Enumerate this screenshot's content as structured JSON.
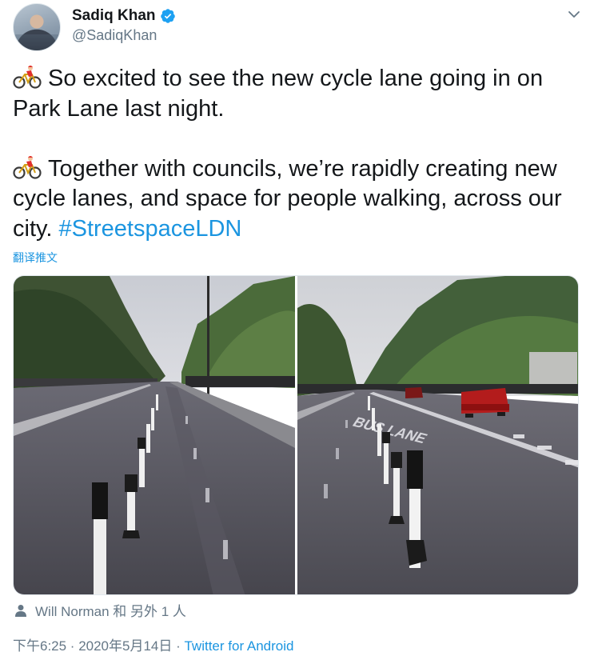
{
  "author": {
    "display_name": "Sadiq Khan",
    "handle": "@SadiqKhan",
    "verified": true
  },
  "tweet": {
    "paragraph1": "So excited to see the new cycle lane going in on Park Lane last night.",
    "paragraph2": "Together with councils, we’re rapidly creating new cycle lanes, and space for people walking, across our city.",
    "hashtag": "#StreetspaceLDN",
    "emoji": "cyclist-emoji"
  },
  "translate_label": "翻译推文",
  "media": {
    "photos": [
      {
        "name": "park-lane-cycle-lane-photo-1"
      },
      {
        "name": "park-lane-cycle-lane-photo-2",
        "road_text": "BUS LANE"
      }
    ]
  },
  "likers_text": "Will Norman 和 另外 1 人",
  "meta": {
    "timestamp": "下午6:25 · 2020年5月14日 · ",
    "source": "Twitter for Android"
  },
  "colors": {
    "link": "#1b95e0",
    "secondary_text": "#657786",
    "verified_badge": "#1da1f2"
  }
}
